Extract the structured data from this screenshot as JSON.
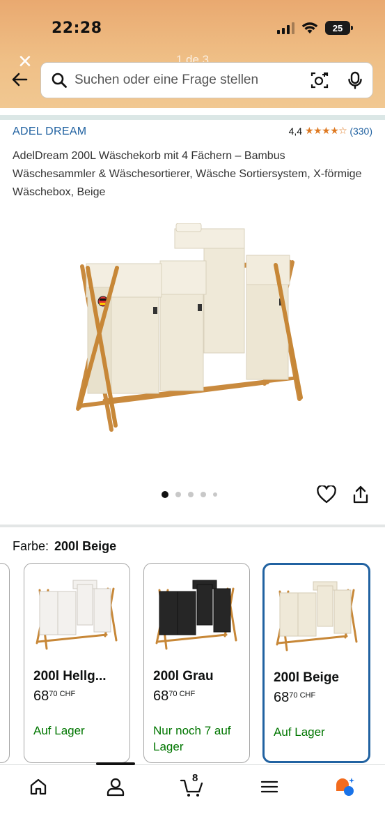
{
  "status_bar": {
    "time": "22:28",
    "battery": "25"
  },
  "header": {
    "page_indicator": "1 de 3",
    "search_placeholder": "Suchen oder eine Frage stellen"
  },
  "product": {
    "brand": "ADEL DREAM",
    "rating_value": "4,4",
    "rating_stars": "★★★★☆",
    "rating_count": "(330)",
    "title": "AdelDream 200L Wäschekorb mit 4 Fächern – Bambus Wäschesammler & Wäschesortierer, Wäsche Sortiersystem, X-förmige Wäschebox, Beige",
    "image_count": 5,
    "image_index": 1
  },
  "color_selector": {
    "label": "Farbe:",
    "selected": "200l Beige",
    "variants": [
      {
        "name": "200l Hellg...",
        "price_whole": "68",
        "price_fraction": "70",
        "currency": "CHF",
        "stock": "Auf Lager",
        "body_color": "#f3f1ee"
      },
      {
        "name": "200l Grau",
        "price_whole": "68",
        "price_fraction": "70",
        "currency": "CHF",
        "stock": "Nur noch 7 auf Lager",
        "body_color": "#262626"
      },
      {
        "name": "200l Beige",
        "price_whole": "68",
        "price_fraction": "70",
        "currency": "CHF",
        "stock": "Auf Lager",
        "body_color": "#efe9d8"
      }
    ]
  },
  "bottom_nav": {
    "items": [
      "home-icon",
      "account-icon",
      "cart-icon",
      "menu-icon",
      "rufus-icon"
    ],
    "cart_count": "8"
  },
  "colors": {
    "accent_blue": "#2162a1",
    "star_orange": "#de7921",
    "stock_green": "#007600"
  }
}
